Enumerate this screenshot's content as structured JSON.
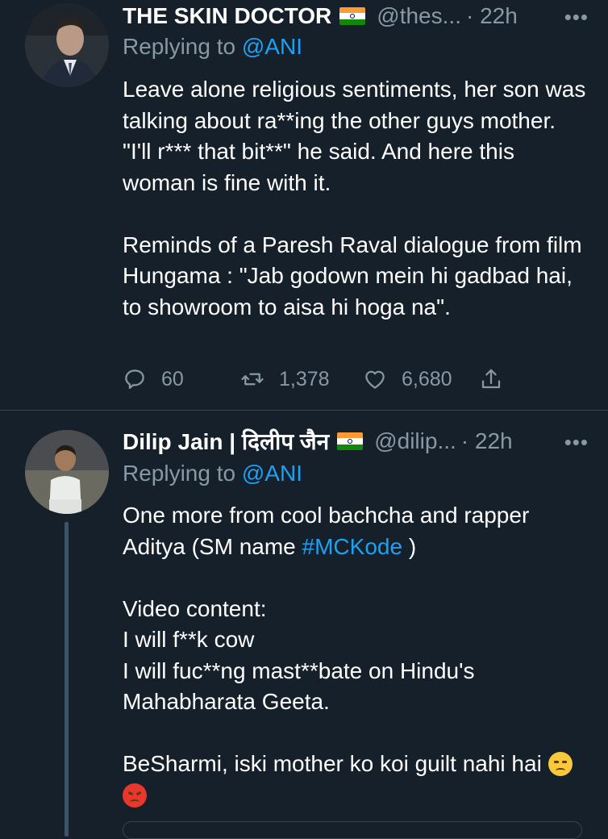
{
  "tweets": [
    {
      "name": "THE SKIN DOCTOR",
      "flag": "india-flag",
      "handle": "@thes...",
      "time": "· 22h",
      "more": "•••",
      "replying_prefix": "Replying to ",
      "replying_to": "@ANI",
      "text": "Leave alone religious sentiments, her son was talking about ra**ing the other guys mother. \"I'll r*** that bit**\" he said. And here this woman is fine with it.\n\nReminds of a Paresh Raval dialogue from film Hungama : \"Jab godown mein hi gadbad hai, to showroom to aisa hi hoga na\".",
      "replies": "60",
      "retweets": "1,378",
      "likes": "6,680"
    },
    {
      "name": "Dilip Jain | दिलीप जैन",
      "flag": "india-flag",
      "handle": "@dilip...",
      "time": "· 22h",
      "more": "•••",
      "replying_prefix": "Replying to ",
      "replying_to": "@ANI",
      "text_part1": "One more from cool bachcha and rapper Aditya (SM name ",
      "hashtag": "#MCKode",
      "text_part2": " )\n\nVideo content:\nI will f**k cow\nI will fuc**ng mast**bate on Hindu's Mahabharata Geeta.\n\nBeSharmi, iski mother ko koi guilt nahi hai ",
      "emojis": [
        "unamused-face-emoji",
        "angry-face-emoji"
      ]
    }
  ],
  "colors": {
    "background": "#15202b",
    "text": "#ffffff",
    "secondary": "#8899a6",
    "link": "#1da1f2",
    "divider": "#38444d"
  }
}
